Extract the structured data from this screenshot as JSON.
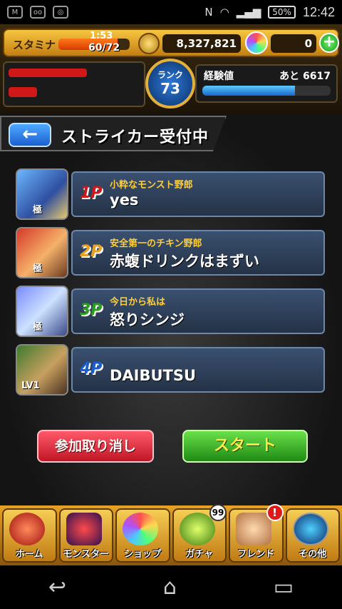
{
  "status_bar": {
    "battery": "50%",
    "time": "12:42"
  },
  "hud": {
    "stamina_label": "スタミナ",
    "stamina_timer": "1:53",
    "stamina_value": "60/72",
    "stamina_fraction": 0.833,
    "gold": "8,327,821",
    "orbs": "0",
    "plus": "+",
    "rank_label": "ランク",
    "rank": "73",
    "exp_label": "経験値",
    "exp_remaining": "あと 6617",
    "exp_fraction": 0.72
  },
  "header": {
    "back_icon": "←",
    "title": "ストライカー受付中"
  },
  "players": [
    {
      "tag": "1P",
      "tag_color": "#d01818",
      "subtitle": "小粋なモンスト野郎",
      "name": "yes",
      "avatar_mark": "極"
    },
    {
      "tag": "2P",
      "tag_color": "#e8a020",
      "subtitle": "安全第一のチキン野郎",
      "name": "赤蝮ドリンクはまずい",
      "avatar_mark": "極"
    },
    {
      "tag": "3P",
      "tag_color": "#2aa01a",
      "subtitle": "今日から私は",
      "name": "怒りシンジ",
      "avatar_mark": "極"
    },
    {
      "tag": "4P",
      "tag_color": "#1a5fd1",
      "subtitle": "",
      "name": "DAIBUTSU",
      "avatar_mark": "LV1"
    }
  ],
  "actions": {
    "cancel": "参加取り消し",
    "start": "スタート"
  },
  "bottom_nav": {
    "home": "ホーム",
    "monster": "モンスター",
    "shop": "ショップ",
    "gacha": "ガチャ",
    "gacha_badge": "99",
    "friend": "フレンド",
    "friend_badge": "!",
    "other": "その他"
  },
  "system_nav": {
    "back": "↩",
    "home": "⌂",
    "recent": "▭"
  }
}
